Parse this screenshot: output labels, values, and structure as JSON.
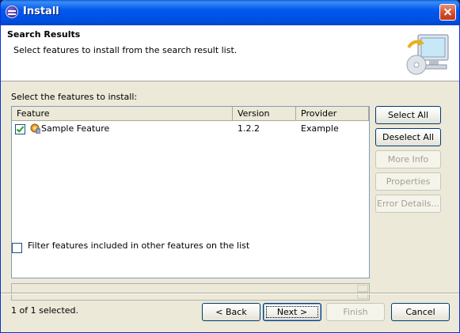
{
  "window": {
    "title": "Install"
  },
  "header": {
    "title": "Search Results",
    "description": "Select features to install from the search result list."
  },
  "main": {
    "select_label": "Select the features to install:",
    "columns": [
      "Feature",
      "Version",
      "Provider"
    ],
    "rows": [
      {
        "checked": true,
        "feature": "Sample Feature",
        "version": "1.2.2",
        "provider": "Example"
      }
    ],
    "status": "1 of 1 selected.",
    "filter_label": "Filter features included in other features on the list"
  },
  "side_buttons": {
    "select_all": "Select All",
    "deselect_all": "Deselect All",
    "more_info": "More Info",
    "properties": "Properties",
    "error_details": "Error Details..."
  },
  "footer_buttons": {
    "back": "< Back",
    "next": "Next >",
    "finish": "Finish",
    "cancel": "Cancel"
  }
}
